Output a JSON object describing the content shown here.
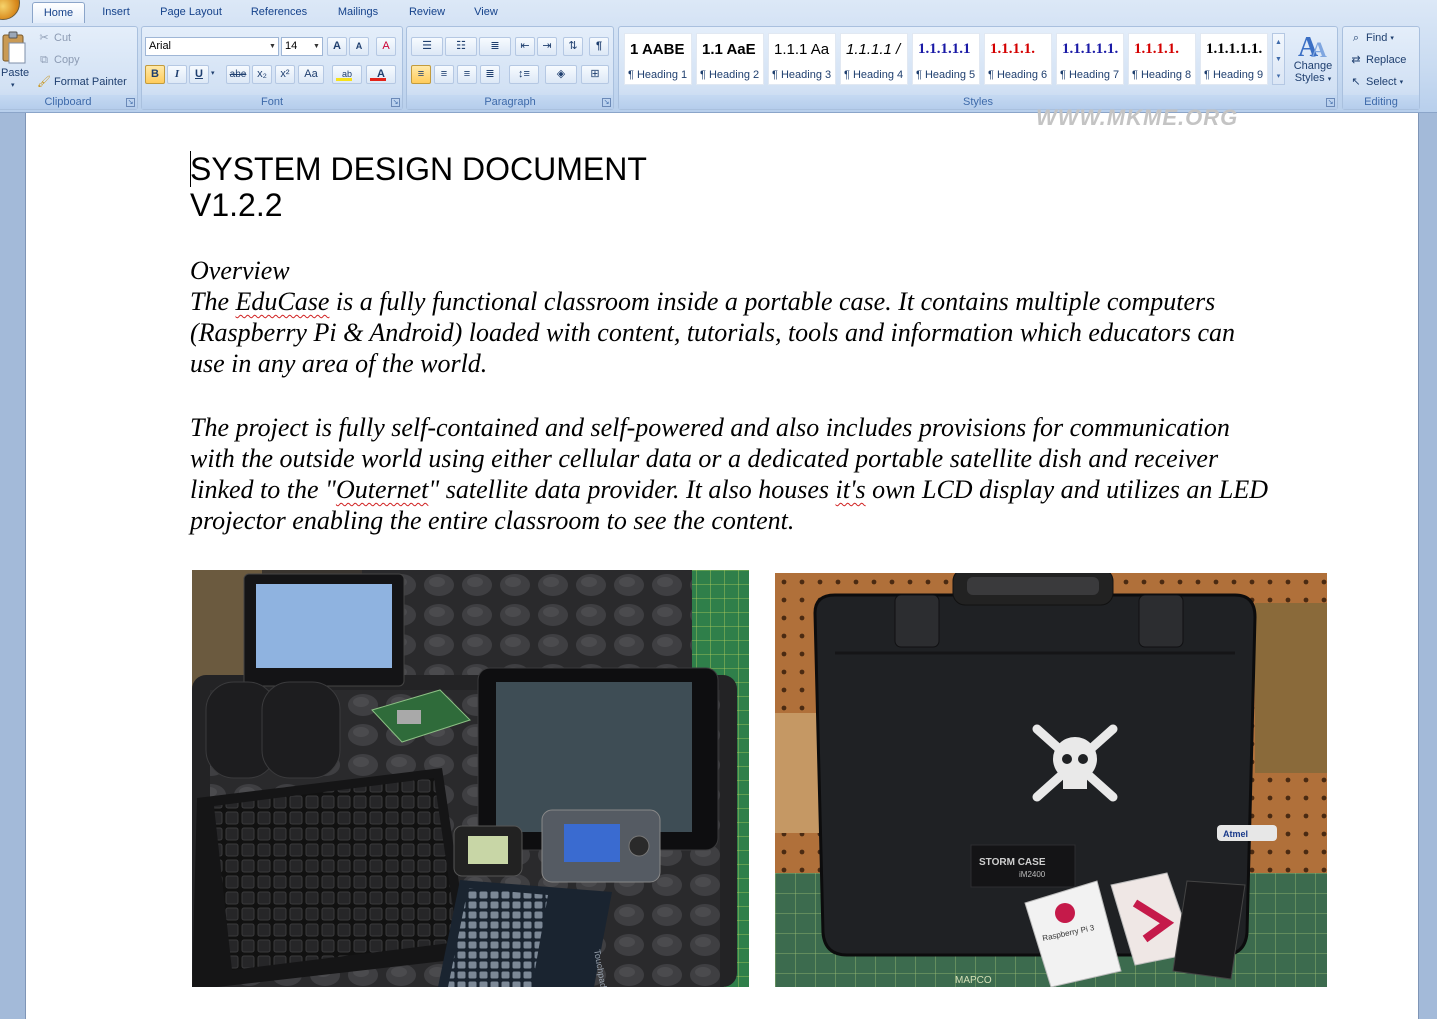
{
  "ribbon": {
    "tabs": [
      {
        "label": "Home",
        "active": true
      },
      {
        "label": "Insert"
      },
      {
        "label": "Page Layout"
      },
      {
        "label": "References"
      },
      {
        "label": "Mailings"
      },
      {
        "label": "Review"
      },
      {
        "label": "View"
      }
    ],
    "clipboard": {
      "group_label": "Clipboard",
      "paste": "Paste",
      "cut": "Cut",
      "copy": "Copy",
      "format_painter": "Format Painter"
    },
    "font": {
      "group_label": "Font",
      "font_name": "Arial",
      "font_size": "14",
      "bold": "B",
      "italic": "I",
      "underline": "U",
      "strike": "abe",
      "subscript": "x₂",
      "superscript": "x²",
      "change_case": "Aa",
      "grow": "A",
      "shrink": "A",
      "clear": "A",
      "highlight": "ab",
      "font_color": "A",
      "highlight_color": "#f6e11b",
      "font_color_value": "#e2231a"
    },
    "paragraph": {
      "group_label": "Paragraph",
      "pilcrow": "¶"
    },
    "styles": {
      "group_label": "Styles",
      "items": [
        {
          "sample": "1  AABE",
          "name": "¶ Heading 1",
          "color": "#000000"
        },
        {
          "sample": "1.1  AaE",
          "name": "¶ Heading 2",
          "color": "#000000"
        },
        {
          "sample": "1.1.1  Aa",
          "name": "¶ Heading 3",
          "color": "#000000"
        },
        {
          "sample": "1.1.1.1  /",
          "name": "¶ Heading 4",
          "color": "#000000"
        },
        {
          "sample": "1.1.1.1.1",
          "name": "¶ Heading 5",
          "color": "#1a1aa6"
        },
        {
          "sample": "1.1.1.1.",
          "name": "¶ Heading 6",
          "color": "#d40000"
        },
        {
          "sample": "1.1.1.1.1.",
          "name": "¶ Heading 7",
          "color": "#1a1aa6"
        },
        {
          "sample": "1.1.1.1.",
          "name": "¶ Heading 8",
          "color": "#d40000"
        },
        {
          "sample": "1.1.1.1.1.",
          "name": "¶ Heading 9",
          "color": "#000000"
        }
      ],
      "change_styles_line1": "Change",
      "change_styles_line2": "Styles"
    },
    "editing": {
      "group_label": "Editing",
      "find": "Find",
      "replace": "Replace",
      "select": "Select"
    }
  },
  "document": {
    "watermark": "WWW.MKME.ORG",
    "title_line1": "SYSTEM DESIGN DOCUMENT",
    "title_line2": "V1.2.2",
    "overview_heading": "Overview",
    "p1_before": "The ",
    "p1_misspelled": "EduCase",
    "p1_after": " is a fully functional classroom inside a portable case. It contains multiple computers (Raspberry Pi & Android) loaded with content, tutorials, tools and information which educators can use in any area of the world.",
    "p2_before": "The project is fully self-contained and self-powered and also includes provisions for communication with the outside world using either cellular data or a dedicated portable satellite dish and receiver  linked to the \"",
    "p2_misspelled_1": "Outernet",
    "p2_middle": "\" satellite data provider. It also houses ",
    "p2_misspelled_2": "it's",
    "p2_after": " own LCD display and utilizes an LED projector enabling the entire classroom to  see the content.",
    "photo_left_case_label": "",
    "photo_right_case_label": "STORM CASE",
    "photo_right_case_model": "iM2400",
    "photo_right_box_label": "Raspberry Pi 3",
    "photo_right_mat_label": "MAPCO",
    "photo_right_sticker": "Atmel",
    "photo_left_pad_label": "Touchpad"
  }
}
